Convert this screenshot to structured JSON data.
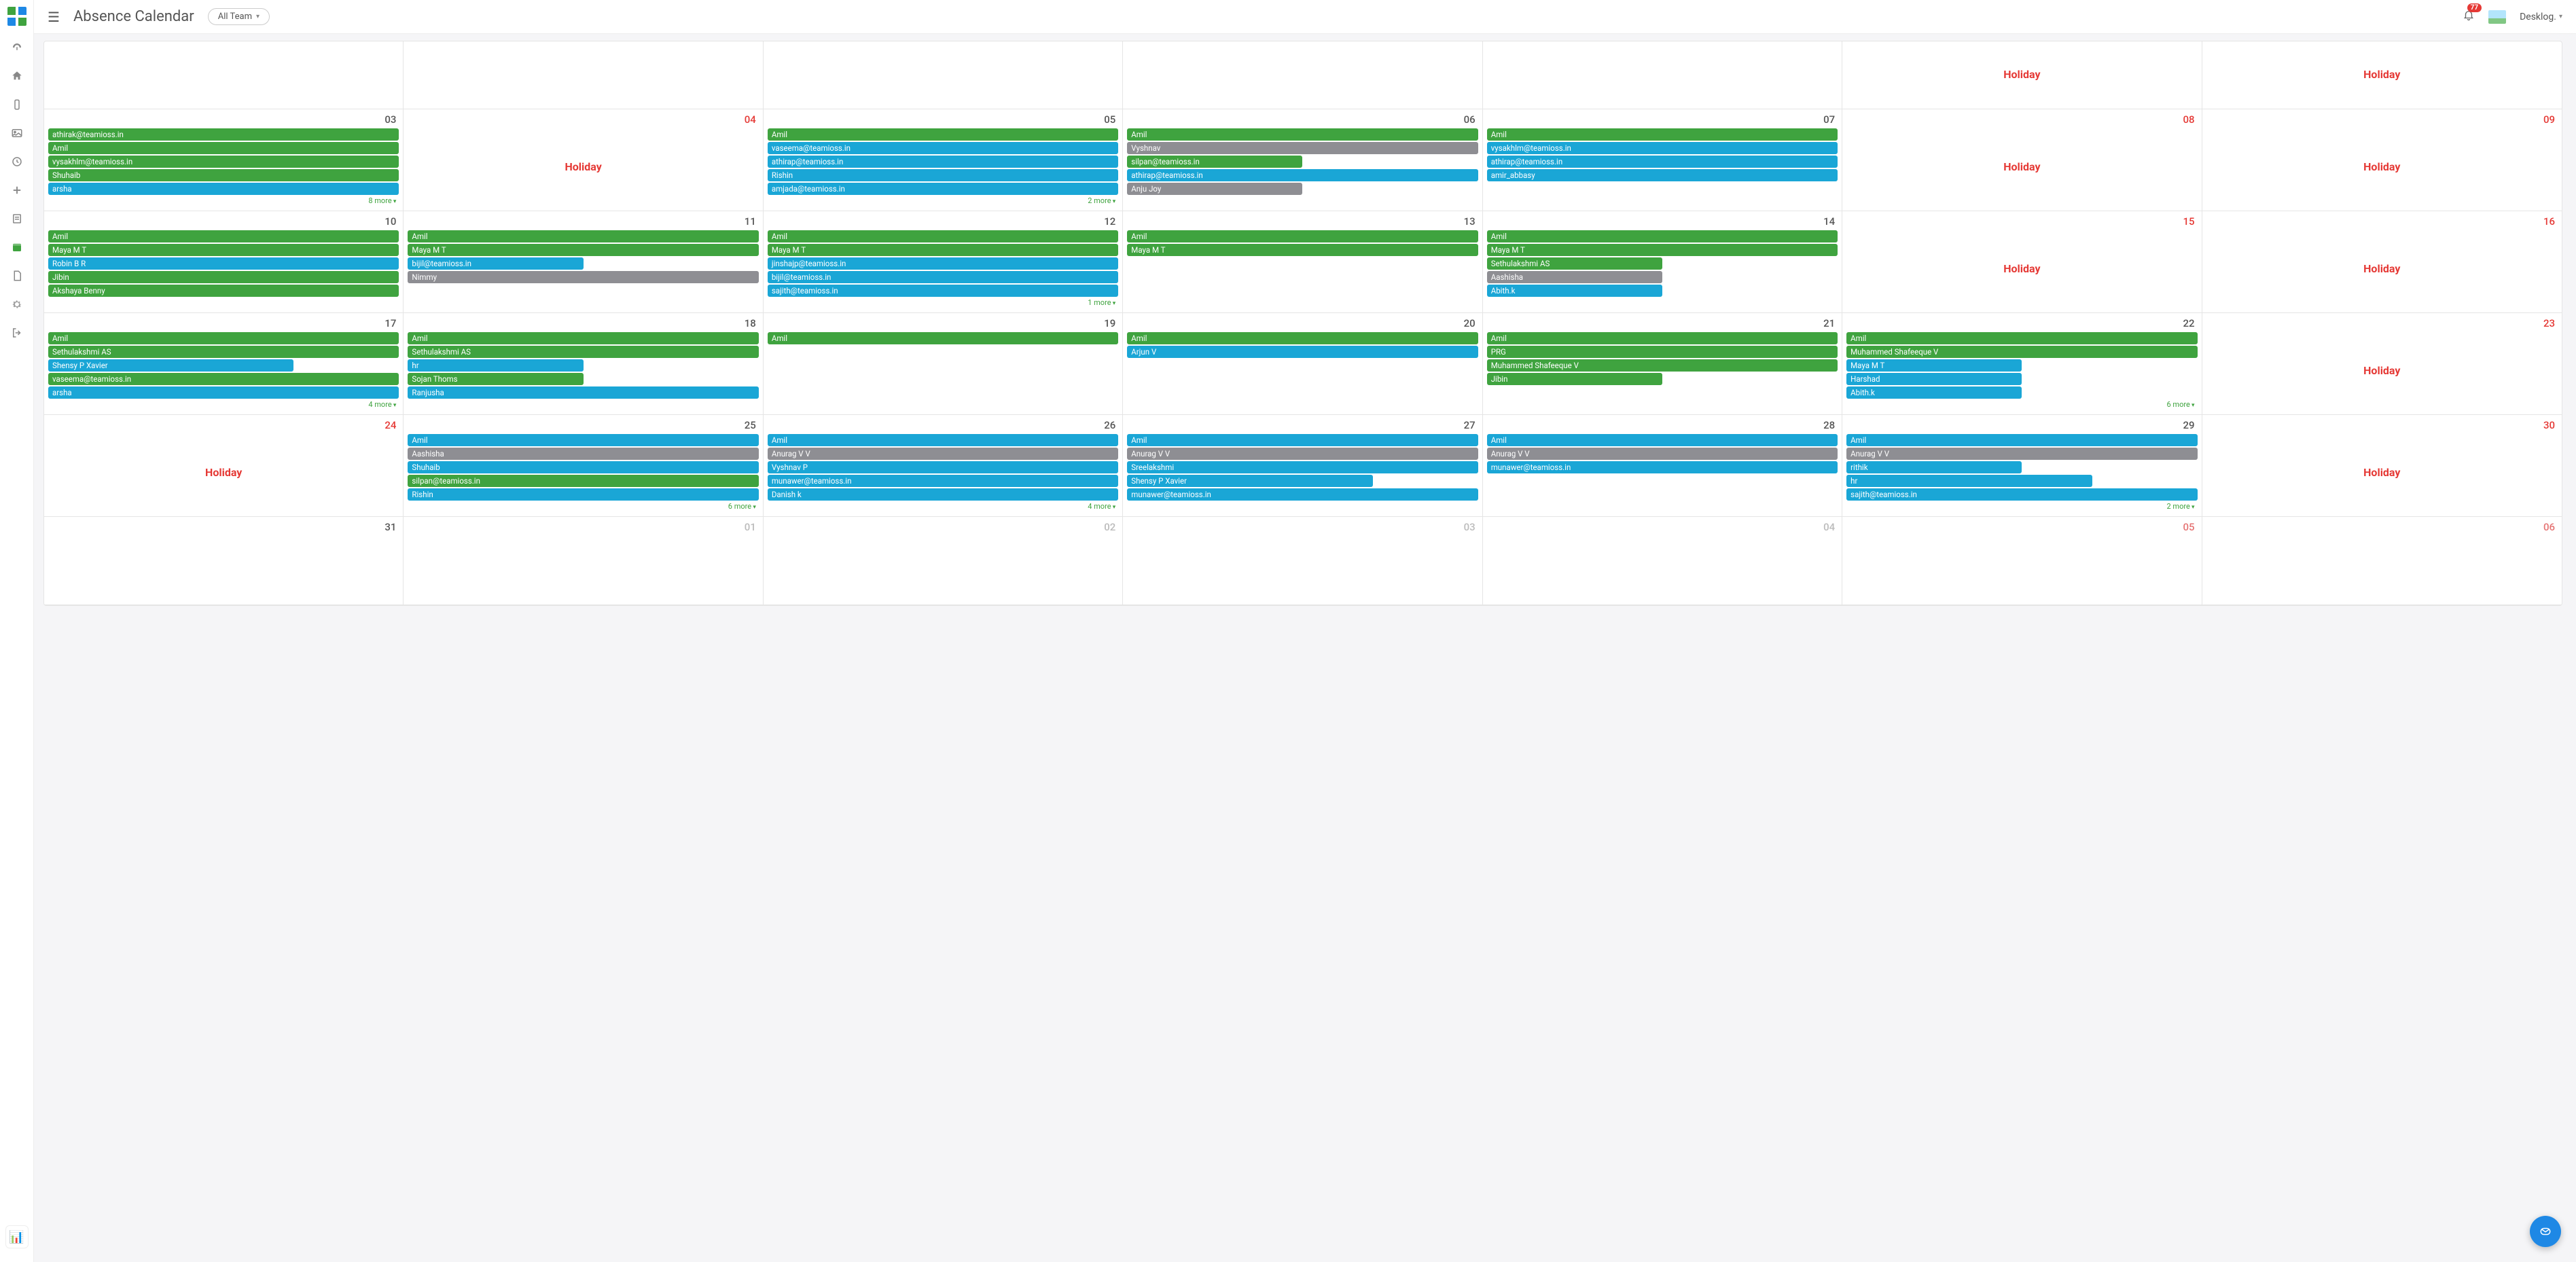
{
  "header": {
    "title": "Absence Calendar",
    "team_filter": "All Team",
    "notif_count": "77",
    "user_label": "Desklog."
  },
  "calendar": {
    "weeks": [
      [
        {
          "num": "",
          "events": [],
          "holiday": false
        },
        {
          "num": "",
          "events": [],
          "holiday": false
        },
        {
          "num": "",
          "events": [],
          "holiday": false
        },
        {
          "num": "",
          "events": [],
          "holiday": false
        },
        {
          "num": "",
          "events": [],
          "holiday": false
        },
        {
          "num": "",
          "events": [],
          "holiday": true,
          "holiday_text": "Holiday"
        },
        {
          "num": "",
          "events": [],
          "holiday": true,
          "holiday_text": "Holiday"
        }
      ],
      [
        {
          "num": "03",
          "events": [
            {
              "t": "athirak@teamioss.in",
              "c": "green"
            },
            {
              "t": "Amil",
              "c": "green"
            },
            {
              "t": "vysakhlm@teamioss.in",
              "c": "green"
            },
            {
              "t": "Shuhaib",
              "c": "green"
            },
            {
              "t": "arsha",
              "c": "blue"
            }
          ],
          "more": "8 more"
        },
        {
          "num": "04",
          "holiday": true,
          "holiday_text": "Holiday",
          "weekend": true,
          "events": []
        },
        {
          "num": "05",
          "events": [
            {
              "t": "Amil",
              "c": "green"
            },
            {
              "t": "vaseema@teamioss.in",
              "c": "blue"
            },
            {
              "t": "athirap@teamioss.in",
              "c": "blue"
            },
            {
              "t": "Rishin",
              "c": "blue"
            },
            {
              "t": "amjada@teamioss.in",
              "c": "blue"
            }
          ],
          "more": "2 more"
        },
        {
          "num": "06",
          "events": [
            {
              "t": "Amil",
              "c": "green"
            },
            {
              "t": "Vyshnav",
              "c": "gray"
            },
            {
              "t": "silpan@teamioss.in",
              "c": "green",
              "w": "short"
            },
            {
              "t": "athirap@teamioss.in",
              "c": "blue"
            },
            {
              "t": "Anju Joy",
              "c": "gray",
              "w": "short"
            }
          ]
        },
        {
          "num": "07",
          "events": [
            {
              "t": "Amil",
              "c": "green"
            },
            {
              "t": "vysakhlm@teamioss.in",
              "c": "blue"
            },
            {
              "t": "athirap@teamioss.in",
              "c": "blue"
            },
            {
              "t": "amir_abbasy",
              "c": "blue"
            }
          ]
        },
        {
          "num": "08",
          "holiday": true,
          "holiday_text": "Holiday",
          "weekend": true,
          "events": []
        },
        {
          "num": "09",
          "holiday": true,
          "holiday_text": "Holiday",
          "weekend": true,
          "events": []
        }
      ],
      [
        {
          "num": "10",
          "events": [
            {
              "t": "Amil",
              "c": "green"
            },
            {
              "t": "Maya M T",
              "c": "green"
            },
            {
              "t": "Robin B R",
              "c": "blue"
            },
            {
              "t": "Jibin",
              "c": "green"
            },
            {
              "t": "Akshaya Benny",
              "c": "green"
            }
          ]
        },
        {
          "num": "11",
          "events": [
            {
              "t": "Amil",
              "c": "green"
            },
            {
              "t": "Maya M T",
              "c": "green"
            },
            {
              "t": "bijil@teamioss.in",
              "c": "blue",
              "w": "short"
            },
            {
              "t": "Nimmy",
              "c": "gray"
            }
          ]
        },
        {
          "num": "12",
          "events": [
            {
              "t": "Amil",
              "c": "green"
            },
            {
              "t": "Maya M T",
              "c": "green"
            },
            {
              "t": "jinshajp@teamioss.in",
              "c": "blue"
            },
            {
              "t": "bijil@teamioss.in",
              "c": "blue"
            },
            {
              "t": "sajith@teamioss.in",
              "c": "blue"
            }
          ],
          "more": "1 more"
        },
        {
          "num": "13",
          "events": [
            {
              "t": "Amil",
              "c": "green"
            },
            {
              "t": "Maya M T",
              "c": "green"
            }
          ]
        },
        {
          "num": "14",
          "events": [
            {
              "t": "Amil",
              "c": "green"
            },
            {
              "t": "Maya M T",
              "c": "green"
            },
            {
              "t": "Sethulakshmi AS",
              "c": "green",
              "w": "short"
            },
            {
              "t": "Aashisha",
              "c": "gray",
              "w": "short"
            },
            {
              "t": "Abith.k",
              "c": "blue",
              "w": "short"
            }
          ]
        },
        {
          "num": "15",
          "holiday": true,
          "holiday_text": "Holiday",
          "weekend": true,
          "events": []
        },
        {
          "num": "16",
          "holiday": true,
          "holiday_text": "Holiday",
          "weekend": true,
          "events": []
        }
      ],
      [
        {
          "num": "17",
          "events": [
            {
              "t": "Amil",
              "c": "green"
            },
            {
              "t": "Sethulakshmi AS",
              "c": "green"
            },
            {
              "t": "Shensy P Xavier",
              "c": "blue",
              "w": "med"
            },
            {
              "t": "vaseema@teamioss.in",
              "c": "green"
            },
            {
              "t": "arsha",
              "c": "blue"
            }
          ],
          "more": "4 more"
        },
        {
          "num": "18",
          "events": [
            {
              "t": "Amil",
              "c": "green"
            },
            {
              "t": "Sethulakshmi AS",
              "c": "green"
            },
            {
              "t": "hr",
              "c": "blue",
              "w": "short"
            },
            {
              "t": "Sojan Thoms",
              "c": "green",
              "w": "short"
            },
            {
              "t": "Ranjusha",
              "c": "blue"
            }
          ]
        },
        {
          "num": "19",
          "events": [
            {
              "t": "Amil",
              "c": "green"
            }
          ]
        },
        {
          "num": "20",
          "events": [
            {
              "t": "Amil",
              "c": "green"
            },
            {
              "t": "Arjun V",
              "c": "blue"
            }
          ]
        },
        {
          "num": "21",
          "events": [
            {
              "t": "Amil",
              "c": "green"
            },
            {
              "t": "PRG",
              "c": "green"
            },
            {
              "t": "Muhammed Shafeeque V",
              "c": "green"
            },
            {
              "t": "Jibin",
              "c": "green",
              "w": "short"
            }
          ]
        },
        {
          "num": "22",
          "events": [
            {
              "t": "Amil",
              "c": "green"
            },
            {
              "t": "Muhammed Shafeeque V",
              "c": "green"
            },
            {
              "t": "Maya M T",
              "c": "blue",
              "w": "short"
            },
            {
              "t": "Harshad",
              "c": "blue",
              "w": "short"
            },
            {
              "t": "Abith.k",
              "c": "blue",
              "w": "short"
            }
          ],
          "more": "6 more"
        },
        {
          "num": "23",
          "holiday": true,
          "holiday_text": "Holiday",
          "weekend": true,
          "events": []
        }
      ],
      [
        {
          "num": "24",
          "holiday": true,
          "holiday_text": "Holiday",
          "weekend": true,
          "events": []
        },
        {
          "num": "25",
          "events": [
            {
              "t": "Amil",
              "c": "blue"
            },
            {
              "t": "Aashisha",
              "c": "gray"
            },
            {
              "t": "Shuhaib",
              "c": "blue"
            },
            {
              "t": "silpan@teamioss.in",
              "c": "green"
            },
            {
              "t": "Rishin",
              "c": "blue"
            }
          ],
          "more": "6 more"
        },
        {
          "num": "26",
          "events": [
            {
              "t": "Amil",
              "c": "blue"
            },
            {
              "t": "Anurag V V",
              "c": "gray"
            },
            {
              "t": "Vyshnav P",
              "c": "blue"
            },
            {
              "t": "munawer@teamioss.in",
              "c": "blue"
            },
            {
              "t": "Danish k",
              "c": "blue"
            }
          ],
          "more": "4 more"
        },
        {
          "num": "27",
          "events": [
            {
              "t": "Amil",
              "c": "blue"
            },
            {
              "t": "Anurag V V",
              "c": "gray"
            },
            {
              "t": "Sreelakshmi",
              "c": "blue"
            },
            {
              "t": "Shensy P Xavier",
              "c": "blue",
              "w": "med"
            },
            {
              "t": "munawer@teamioss.in",
              "c": "blue"
            }
          ]
        },
        {
          "num": "28",
          "events": [
            {
              "t": "Amil",
              "c": "blue"
            },
            {
              "t": "Anurag V V",
              "c": "gray"
            },
            {
              "t": "munawer@teamioss.in",
              "c": "blue"
            }
          ]
        },
        {
          "num": "29",
          "events": [
            {
              "t": "Amil",
              "c": "blue"
            },
            {
              "t": "Anurag V V",
              "c": "gray"
            },
            {
              "t": "rithik",
              "c": "blue",
              "w": "short"
            },
            {
              "t": "hr",
              "c": "blue",
              "w": "med"
            },
            {
              "t": "sajith@teamioss.in",
              "c": "blue"
            }
          ],
          "more": "2 more"
        },
        {
          "num": "30",
          "holiday": true,
          "holiday_text": "Holiday",
          "weekend": true,
          "events": []
        }
      ],
      [
        {
          "num": "31",
          "events": []
        },
        {
          "num": "01",
          "events": [],
          "muted": true
        },
        {
          "num": "02",
          "events": [],
          "muted": true
        },
        {
          "num": "03",
          "events": [],
          "muted": true
        },
        {
          "num": "04",
          "events": [],
          "muted": true
        },
        {
          "num": "05",
          "events": [],
          "muted": true,
          "weekend": true
        },
        {
          "num": "06",
          "events": [],
          "muted": true,
          "weekend": true
        }
      ]
    ]
  }
}
